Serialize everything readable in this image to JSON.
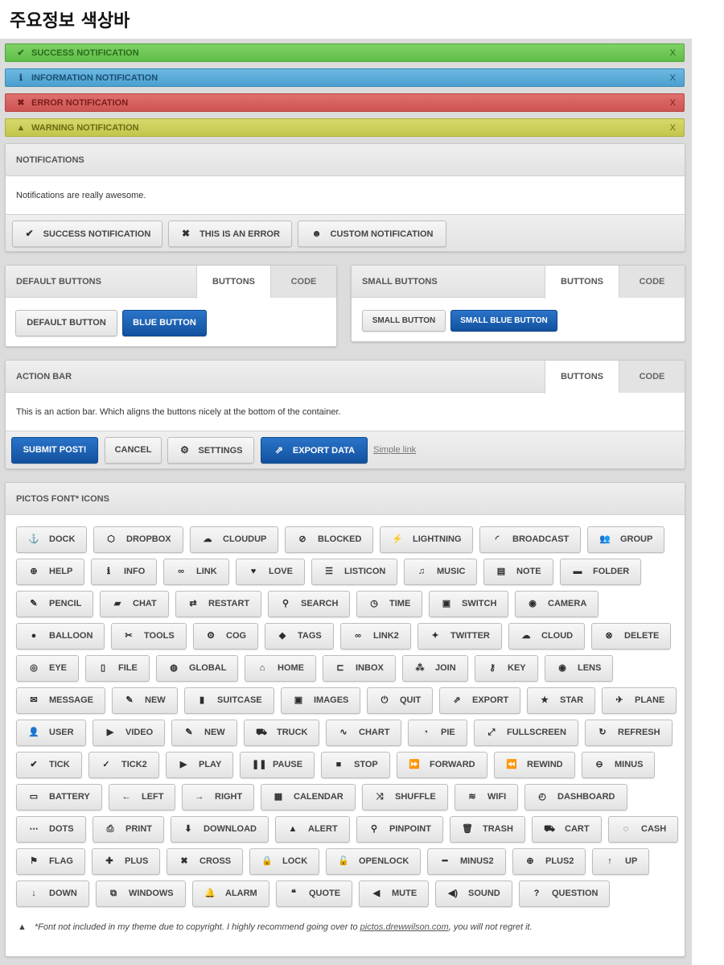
{
  "page": {
    "title": "주요정보 색상바"
  },
  "notifications": [
    {
      "type": "success",
      "icon": "check-icon",
      "glyph": "✔",
      "text": "SUCCESS NOTIFICATION",
      "close": "X",
      "color": "#5fbd47"
    },
    {
      "type": "info",
      "icon": "info-icon",
      "glyph": "ℹ",
      "text": "INFORMATION NOTIFICATION",
      "close": "X",
      "color": "#4a9fcf"
    },
    {
      "type": "error",
      "icon": "cross-icon",
      "glyph": "✖",
      "text": "ERROR NOTIFICATION",
      "close": "X",
      "color": "#cd5452"
    },
    {
      "type": "warning",
      "icon": "warning-icon",
      "glyph": "▲",
      "text": "WARNING NOTIFICATION",
      "close": "X",
      "color": "#c3c64c"
    }
  ],
  "notifications_panel": {
    "title": "NOTIFICATIONS",
    "body": "Notifications are really awesome.",
    "buttons": [
      {
        "label": "SUCCESS NOTIFICATION",
        "icon": "check-icon",
        "glyph": "✔"
      },
      {
        "label": "THIS IS AN ERROR",
        "icon": "cross-icon",
        "glyph": "✖"
      },
      {
        "label": "CUSTOM NOTIFICATION",
        "icon": "user-icon",
        "glyph": "👤"
      }
    ]
  },
  "default_buttons": {
    "title": "DEFAULT BUTTONS",
    "tabs": [
      "BUTTONS",
      "CODE"
    ],
    "default_label": "DEFAULT BUTTON",
    "blue_label": "BLUE BUTTON"
  },
  "small_buttons": {
    "title": "SMALL BUTTONS",
    "tabs": [
      "BUTTONS",
      "CODE"
    ],
    "small_label": "SMALL BUTTON",
    "small_blue_label": "SMALL BLUE BUTTON"
  },
  "action_bar": {
    "title": "ACTION BAR",
    "tabs": [
      "BUTTONS",
      "CODE"
    ],
    "body": "This is an action bar. Which aligns the buttons nicely at the bottom of the container.",
    "submit_label": "SUBMIT POST!",
    "cancel_label": "CANCEL",
    "settings_label": "SETTINGS",
    "export_label": "EXPORT DATA",
    "link_label": "Simple link"
  },
  "icons_panel": {
    "title": "PICTOS FONT* ICONS",
    "rows": [
      [
        {
          "label": "DOCK",
          "icon": "dock-icon",
          "glyph": "⚓"
        },
        {
          "label": "DROPBOX",
          "icon": "dropbox-icon",
          "glyph": "⬡"
        },
        {
          "label": "CLOUDUP",
          "icon": "cloudup-icon",
          "glyph": "☁"
        },
        {
          "label": "BLOCKED",
          "icon": "blocked-icon",
          "glyph": "⊘"
        },
        {
          "label": "LIGHTNING",
          "icon": "lightning-icon",
          "glyph": "⚡"
        },
        {
          "label": "BROADCAST",
          "icon": "broadcast-icon",
          "glyph": "◜"
        },
        {
          "label": "GROUP",
          "icon": "group-icon",
          "glyph": "👥"
        }
      ],
      [
        {
          "label": "HELP",
          "icon": "help-icon",
          "glyph": "⊕"
        },
        {
          "label": "INFO",
          "icon": "info-icon",
          "glyph": "ℹ"
        },
        {
          "label": "LINK",
          "icon": "link-icon",
          "glyph": "∞"
        },
        {
          "label": "LOVE",
          "icon": "love-icon",
          "glyph": "♥"
        },
        {
          "label": "LISTICON",
          "icon": "list-icon",
          "glyph": "☰"
        },
        {
          "label": "MUSIC",
          "icon": "music-icon",
          "glyph": "♫"
        },
        {
          "label": "NOTE",
          "icon": "note-icon",
          "glyph": "▤"
        },
        {
          "label": "FOLDER",
          "icon": "folder-icon",
          "glyph": "▬"
        }
      ],
      [
        {
          "label": "PENCIL",
          "icon": "pencil-icon",
          "glyph": "✎"
        },
        {
          "label": "CHAT",
          "icon": "chat-icon",
          "glyph": "▰"
        },
        {
          "label": "RESTART",
          "icon": "restart-icon",
          "glyph": "⇄"
        },
        {
          "label": "SEARCH",
          "icon": "search-icon",
          "glyph": "⚲"
        },
        {
          "label": "TIME",
          "icon": "clock-icon",
          "glyph": "◷"
        },
        {
          "label": "SWITCH",
          "icon": "switch-icon",
          "glyph": "▣"
        },
        {
          "label": "CAMERA",
          "icon": "camera-icon",
          "glyph": "◉"
        }
      ],
      [
        {
          "label": "BALLOON",
          "icon": "balloon-icon",
          "glyph": "●"
        },
        {
          "label": "TOOLS",
          "icon": "tools-icon",
          "glyph": "✂"
        },
        {
          "label": "COG",
          "icon": "cog-icon",
          "glyph": "⚙"
        },
        {
          "label": "TAGS",
          "icon": "tags-icon",
          "glyph": "◆"
        },
        {
          "label": "LINK2",
          "icon": "link2-icon",
          "glyph": "∞"
        },
        {
          "label": "TWITTER",
          "icon": "twitter-icon",
          "glyph": "✦"
        },
        {
          "label": "CLOUD",
          "icon": "cloud-icon",
          "glyph": "☁"
        },
        {
          "label": "DELETE",
          "icon": "delete-icon",
          "glyph": "⊗"
        }
      ],
      [
        {
          "label": "EYE",
          "icon": "eye-icon",
          "glyph": "◎"
        },
        {
          "label": "FILE",
          "icon": "file-icon",
          "glyph": "▯"
        },
        {
          "label": "GLOBAL",
          "icon": "globe-icon",
          "glyph": "◍"
        },
        {
          "label": "HOME",
          "icon": "home-icon",
          "glyph": "⌂"
        },
        {
          "label": "INBOX",
          "icon": "inbox-icon",
          "glyph": "⊏"
        },
        {
          "label": "JOIN",
          "icon": "join-icon",
          "glyph": "⁂"
        },
        {
          "label": "KEY",
          "icon": "key-icon",
          "glyph": "⚷"
        },
        {
          "label": "LENS",
          "icon": "lens-icon",
          "glyph": "◉"
        }
      ],
      [
        {
          "label": "MESSAGE",
          "icon": "message-icon",
          "glyph": "✉"
        },
        {
          "label": "NEW",
          "icon": "new-icon",
          "glyph": "✎"
        },
        {
          "label": "SUITCASE",
          "icon": "suitcase-icon",
          "glyph": "▮"
        },
        {
          "label": "IMAGES",
          "icon": "images-icon",
          "glyph": "▣"
        },
        {
          "label": "QUIT",
          "icon": "power-icon",
          "glyph": "⏻"
        },
        {
          "label": "EXPORT",
          "icon": "export-icon",
          "glyph": "⇗"
        },
        {
          "label": "STAR",
          "icon": "star-icon",
          "glyph": "★"
        },
        {
          "label": "PLANE",
          "icon": "plane-icon",
          "glyph": "✈"
        }
      ],
      [
        {
          "label": "USER",
          "icon": "user-icon",
          "glyph": "👤"
        },
        {
          "label": "VIDEO",
          "icon": "video-icon",
          "glyph": "▶"
        },
        {
          "label": "NEW",
          "icon": "new-icon",
          "glyph": "✎"
        },
        {
          "label": "TRUCK",
          "icon": "truck-icon",
          "glyph": "⛟"
        },
        {
          "label": "CHART",
          "icon": "chart-icon",
          "glyph": "∿"
        },
        {
          "label": "PIE",
          "icon": "pie-icon",
          "glyph": "◔"
        },
        {
          "label": "FULLSCREEN",
          "icon": "fullscreen-icon",
          "glyph": "⤢"
        },
        {
          "label": "REFRESH",
          "icon": "refresh-icon",
          "glyph": "↻"
        }
      ],
      [
        {
          "label": "TICK",
          "icon": "tick-icon",
          "glyph": "✔"
        },
        {
          "label": "TICK2",
          "icon": "tick2-icon",
          "glyph": "✓"
        },
        {
          "label": "PLAY",
          "icon": "play-icon",
          "glyph": "▶"
        },
        {
          "label": "PAUSE",
          "icon": "pause-icon",
          "glyph": "❚❚"
        },
        {
          "label": "STOP",
          "icon": "stop-icon",
          "glyph": "■"
        },
        {
          "label": "FORWARD",
          "icon": "forward-icon",
          "glyph": "⏩"
        },
        {
          "label": "REWIND",
          "icon": "rewind-icon",
          "glyph": "⏪"
        },
        {
          "label": "MINUS",
          "icon": "minus-icon",
          "glyph": "⊖"
        }
      ],
      [
        {
          "label": "BATTERY",
          "icon": "battery-icon",
          "glyph": "▭"
        },
        {
          "label": "LEFT",
          "icon": "arrow-left-icon",
          "glyph": "←"
        },
        {
          "label": "RIGHT",
          "icon": "arrow-right-icon",
          "glyph": "→"
        },
        {
          "label": "CALENDAR",
          "icon": "calendar-icon",
          "glyph": "▦"
        },
        {
          "label": "SHUFFLE",
          "icon": "shuffle-icon",
          "glyph": "⤨"
        },
        {
          "label": "WIFI",
          "icon": "wifi-icon",
          "glyph": "≋"
        },
        {
          "label": "DASHBOARD",
          "icon": "dashboard-icon",
          "glyph": "◴"
        }
      ],
      [
        {
          "label": "DOTS",
          "icon": "dots-icon",
          "glyph": "⋯"
        },
        {
          "label": "PRINT",
          "icon": "print-icon",
          "glyph": "⎙"
        },
        {
          "label": "DOWNLOAD",
          "icon": "download-icon",
          "glyph": "⬇"
        },
        {
          "label": "ALERT",
          "icon": "alert-icon",
          "glyph": "▲"
        },
        {
          "label": "PINPOINT",
          "icon": "pinpoint-icon",
          "glyph": "⚲"
        },
        {
          "label": "TRASH",
          "icon": "trash-icon",
          "glyph": "🗑"
        },
        {
          "label": "CART",
          "icon": "cart-icon",
          "glyph": "⛟"
        },
        {
          "label": "CASH",
          "icon": "cash-icon",
          "glyph": "◌"
        }
      ],
      [
        {
          "label": "FLAG",
          "icon": "flag-icon",
          "glyph": "⚑"
        },
        {
          "label": "PLUS",
          "icon": "plus-icon",
          "glyph": "✚"
        },
        {
          "label": "CROSS",
          "icon": "cross-icon",
          "glyph": "✖"
        },
        {
          "label": "LOCK",
          "icon": "lock-icon",
          "glyph": "🔒"
        },
        {
          "label": "OPENLOCK",
          "icon": "openlock-icon",
          "glyph": "🔓"
        },
        {
          "label": "MINUS2",
          "icon": "minus2-icon",
          "glyph": "━"
        },
        {
          "label": "PLUS2",
          "icon": "plus2-icon",
          "glyph": "⊕"
        },
        {
          "label": "UP",
          "icon": "arrow-up-icon",
          "glyph": "↑"
        }
      ],
      [
        {
          "label": "DOWN",
          "icon": "arrow-down-icon",
          "glyph": "↓"
        },
        {
          "label": "WINDOWS",
          "icon": "windows-icon",
          "glyph": "⧉"
        },
        {
          "label": "ALARM",
          "icon": "alarm-icon",
          "glyph": "🔔"
        },
        {
          "label": "QUOTE",
          "icon": "quote-icon",
          "glyph": "❝"
        },
        {
          "label": "MUTE",
          "icon": "mute-icon",
          "glyph": "◀"
        },
        {
          "label": "SOUND",
          "icon": "sound-icon",
          "glyph": "◀)"
        },
        {
          "label": "QUESTION",
          "icon": "question-icon",
          "glyph": "?"
        }
      ]
    ],
    "footnote_prefix": "*Font not included in my theme due to copyright. I highly recommend going over to ",
    "footnote_link": "pictos.drewwilson.com",
    "footnote_suffix": ", you will not regret it."
  }
}
